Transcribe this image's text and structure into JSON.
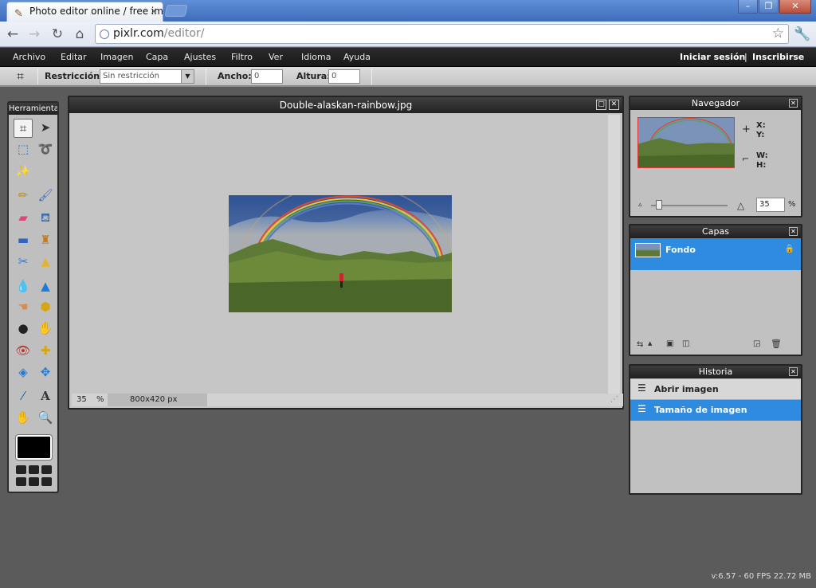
{
  "browser": {
    "tab_title": "Photo editor online / free imag",
    "url_host": "pixlr.com",
    "url_path": "/editor/"
  },
  "menu": {
    "items": [
      "Archivo",
      "Editar",
      "Imagen",
      "Capa",
      "Ajustes",
      "Filtro",
      "Ver",
      "Idioma",
      "Ayuda"
    ],
    "login": "Iniciar sesión",
    "separator": "|",
    "register": "Inscribirse"
  },
  "options": {
    "restriction_label": "Restricción:",
    "restriction_value": "Sin restricción",
    "width_label": "Ancho:",
    "width_value": "0",
    "height_label": "Altura:",
    "height_value": "0"
  },
  "tools": {
    "title": "Herramientas",
    "items": [
      "crop",
      "move",
      "marquee",
      "lasso",
      "wand",
      "pencil",
      "brush",
      "eraser",
      "bucket",
      "gradient",
      "stamp",
      "colorreplace",
      "drawing",
      "blur",
      "sharpen",
      "smudge",
      "sponge",
      "dodge",
      "burn",
      "redeye",
      "spotheal",
      "bloat",
      "pinch",
      "colorpicker",
      "type",
      "hand",
      "zoom"
    ],
    "foreground_color": "#000000"
  },
  "document": {
    "title": "Double-alaskan-rainbow.jpg",
    "zoom": "35",
    "zoom_unit": "%",
    "dimensions": "800x420 px"
  },
  "navigator": {
    "title": "Navegador",
    "x_label": "X:",
    "y_label": "Y:",
    "w_label": "W:",
    "h_label": "H:",
    "zoom": "35",
    "zoom_unit": "%",
    "zoom_fraction": 0.1
  },
  "layers": {
    "title": "Capas",
    "items": [
      {
        "name": "Fondo",
        "selected": true
      }
    ]
  },
  "history": {
    "title": "Historia",
    "items": [
      {
        "label": "Abrir imagen",
        "selected": false
      },
      {
        "label": "Tamaño de imagen",
        "selected": true
      }
    ]
  },
  "status": {
    "fps": "v:6.57 - 60 FPS 22.72 MB"
  },
  "colors": {
    "selection_blue": "#2e8be0",
    "panel_bg": "#c1c1c1",
    "workspace": "#5b5b5b"
  }
}
